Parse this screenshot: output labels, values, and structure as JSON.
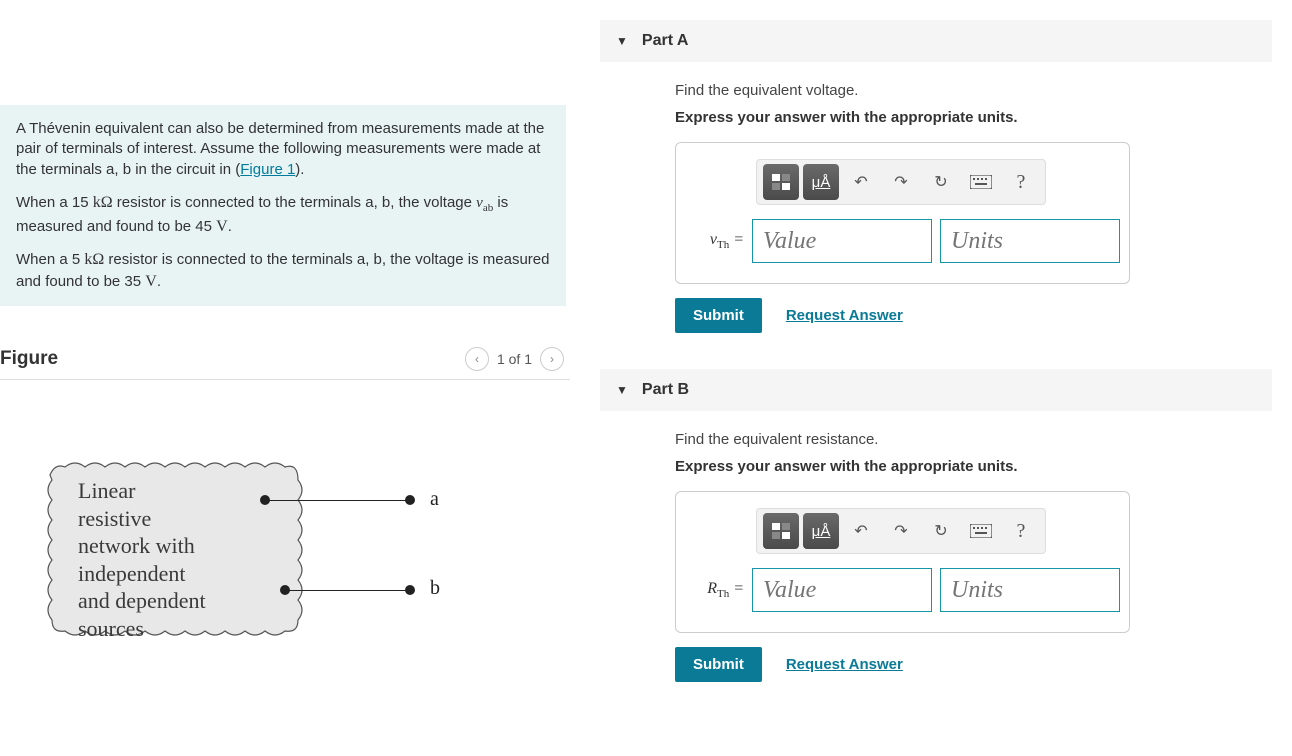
{
  "problem": {
    "p1_prefix": "A Thévenin equivalent can also be determined from measurements made at the pair of terminals of interest. Assume the following measurements were made at the terminals a, b in the circuit in (",
    "figure_link": "Figure 1",
    "p1_suffix": ").",
    "p2_a": "When a 15 ",
    "p2_b": " resistor is connected to the terminals a, b, the voltage ",
    "p2_c": " is measured and found to be 45 ",
    "p2_d": ".",
    "p3_a": "When a 5 ",
    "p3_b": " resistor is connected to the terminals a, b, the voltage is measured and found to be 35 ",
    "p3_c": ".",
    "kohm": "kΩ",
    "vab_v": "v",
    "vab_sub": "ab",
    "volt": "V"
  },
  "figure": {
    "title": "Figure",
    "pager": "1 of 1",
    "box_line1": "Linear",
    "box_line2": "resistive",
    "box_line3": "network with",
    "box_line4": "independent",
    "box_line5": "and dependent",
    "box_line6": "sources",
    "label_a": "a",
    "label_b": "b"
  },
  "partA": {
    "title": "Part A",
    "instruction": "Find the equivalent voltage.",
    "express": "Express your answer with the appropriate units.",
    "var_v": "v",
    "var_sub": "Th",
    "eq": " =",
    "value_ph": "Value",
    "units_ph": "Units",
    "submit": "Submit",
    "request": "Request Answer"
  },
  "partB": {
    "title": "Part B",
    "instruction": "Find the equivalent resistance.",
    "express": "Express your answer with the appropriate units.",
    "var_r": "R",
    "var_sub": "Th",
    "eq": " =",
    "value_ph": "Value",
    "units_ph": "Units",
    "submit": "Submit",
    "request": "Request Answer"
  },
  "toolbar": {
    "mu_a": "μÅ"
  }
}
